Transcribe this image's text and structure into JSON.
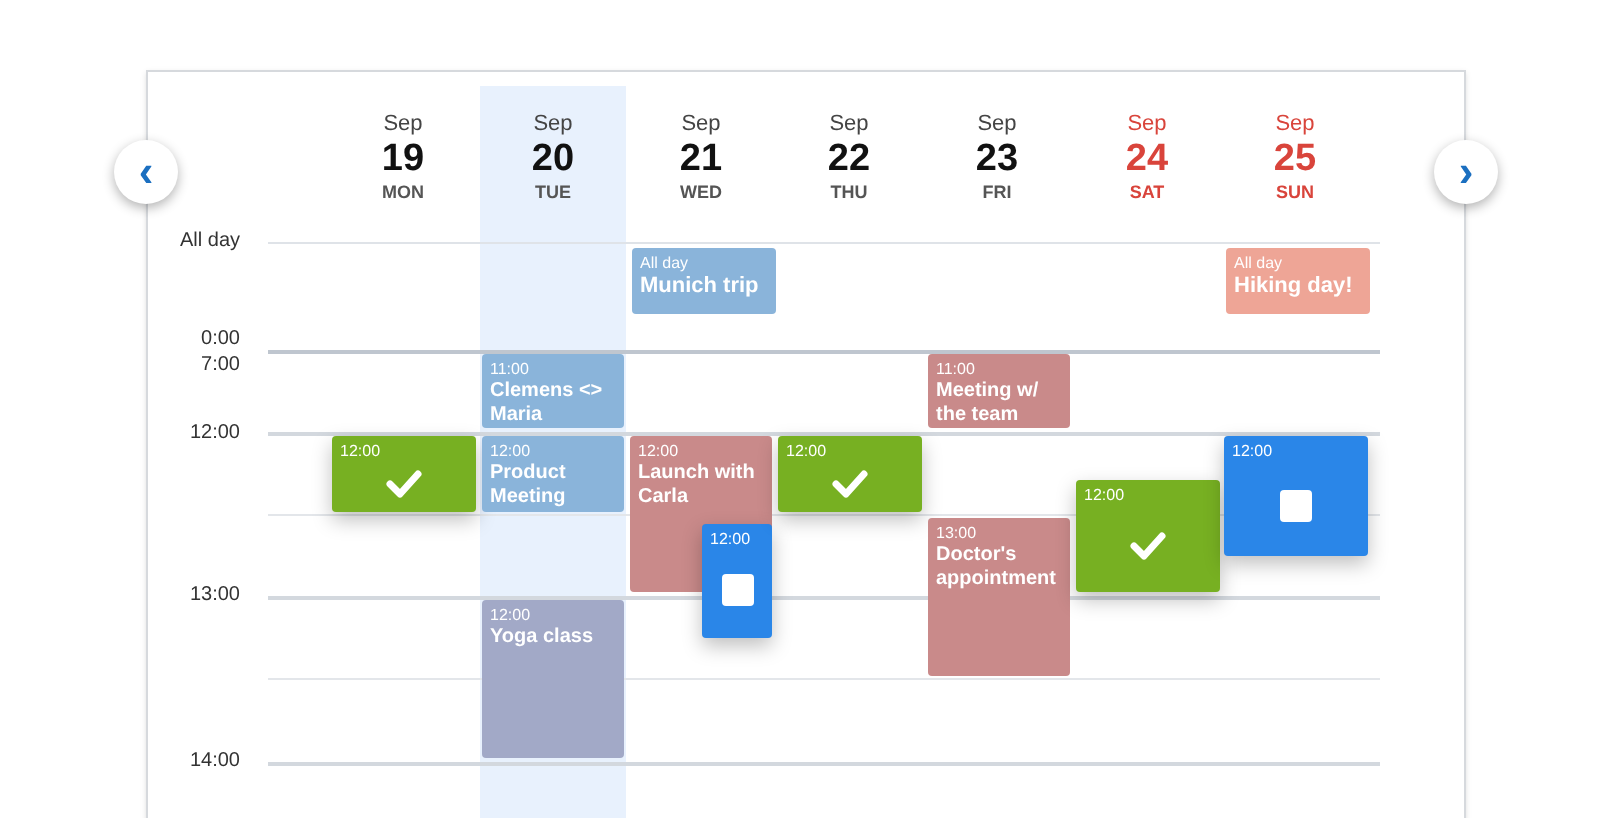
{
  "nav": {
    "previous": "‹",
    "next": "›"
  },
  "days": [
    {
      "month": "Sep",
      "day": "19",
      "weekday": "MON",
      "weekend": false,
      "selected": false,
      "events": [
        {
          "kind": "task",
          "time": "12:00",
          "checked": true,
          "color": "#77b022"
        }
      ]
    },
    {
      "month": "Sep",
      "day": "20",
      "weekday": "TUE",
      "weekend": false,
      "selected": true,
      "events": [
        {
          "kind": "event",
          "time": "11:00",
          "title": "Clemens <> Maria",
          "color": "#8ab4da"
        },
        {
          "kind": "event",
          "time": "12:00",
          "title": "Product Meeting",
          "color": "#8ab4da"
        },
        {
          "kind": "event",
          "time": "12:00",
          "title": "Yoga class",
          "color": "#a2a9c7"
        }
      ]
    },
    {
      "month": "Sep",
      "day": "21",
      "weekday": "WED",
      "weekend": false,
      "selected": false,
      "all_day": {
        "label": "All day",
        "title": "Munich trip",
        "color": "#8ab4da"
      },
      "events": [
        {
          "kind": "event",
          "time": "12:00",
          "title": "Launch with Carla",
          "color": "#c98a8a"
        },
        {
          "kind": "task",
          "time": "12:00",
          "checked": false,
          "color": "#2a86e8"
        }
      ]
    },
    {
      "month": "Sep",
      "day": "22",
      "weekday": "THU",
      "weekend": false,
      "selected": false,
      "events": [
        {
          "kind": "task",
          "time": "12:00",
          "checked": true,
          "color": "#77b022"
        }
      ]
    },
    {
      "month": "Sep",
      "day": "23",
      "weekday": "FRI",
      "weekend": false,
      "selected": false,
      "events": [
        {
          "kind": "event",
          "time": "11:00",
          "title": "Meeting w/ the team",
          "color": "#c98a8a"
        },
        {
          "kind": "event",
          "time": "13:00",
          "title": "Doctor's appointment",
          "color": "#c98a8a"
        }
      ]
    },
    {
      "month": "Sep",
      "day": "24",
      "weekday": "SAT",
      "weekend": true,
      "selected": false,
      "events": [
        {
          "kind": "task",
          "time": "12:00",
          "checked": true,
          "color": "#77b022"
        }
      ]
    },
    {
      "month": "Sep",
      "day": "25",
      "weekday": "SUN",
      "weekend": true,
      "selected": false,
      "all_day": {
        "label": "All day",
        "title": "Hiking day!",
        "color": "#eea596"
      },
      "events": [
        {
          "kind": "task",
          "time": "12:00",
          "checked": false,
          "color": "#2a86e8"
        }
      ]
    }
  ],
  "time_labels": [
    "All day",
    "0:00",
    "7:00",
    "12:00",
    "13:00",
    "14:00"
  ]
}
